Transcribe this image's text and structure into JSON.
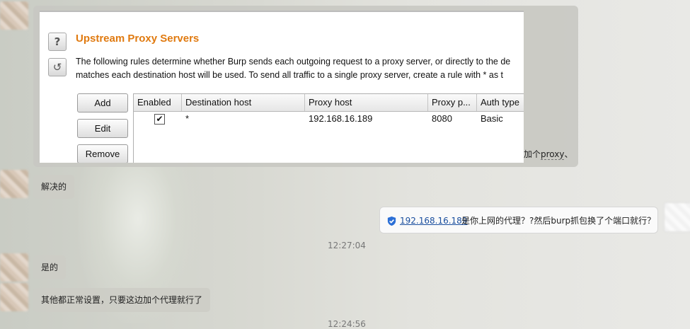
{
  "burp": {
    "title": "Upstream Proxy Servers",
    "description_line1": "The following rules determine whether Burp sends each outgoing request to a proxy server, or directly to the de",
    "description_line2": "matches each destination host will be used. To send all traffic to a single proxy server, create a rule with * as t",
    "help_icon": "?",
    "refresh_icon": "↺",
    "buttons": {
      "add": "Add",
      "edit": "Edit",
      "remove": "Remove"
    },
    "table": {
      "columns": [
        "Enabled",
        "Destination host",
        "Proxy host",
        "Proxy p...",
        "Auth type"
      ],
      "rows": [
        {
          "enabled": "✔",
          "destination_host": "*",
          "proxy_host": "192.168.16.189",
          "proxy_port": "8080",
          "auth_type": "Basic"
        }
      ]
    }
  },
  "chat": {
    "big_bubble_tail": "加个",
    "big_bubble_tail_underlined": "proxy",
    "big_bubble_tail_end": "、",
    "msg_left_1": "解决的",
    "msg_right_link": "192.168.16.189",
    "msg_right_text": "是你上网的代理？?然后burp抓包换了个端口就行？",
    "time_1": "12:27:04",
    "msg_left_2": "是的",
    "msg_left_3": "其他都正常设置，只要这边加个代理就行了",
    "time_2": "12:24:56"
  },
  "icons": {
    "shield": "shield-check-icon"
  },
  "colors": {
    "title_orange": "#e07a10",
    "link_blue": "#1a4e9e"
  }
}
